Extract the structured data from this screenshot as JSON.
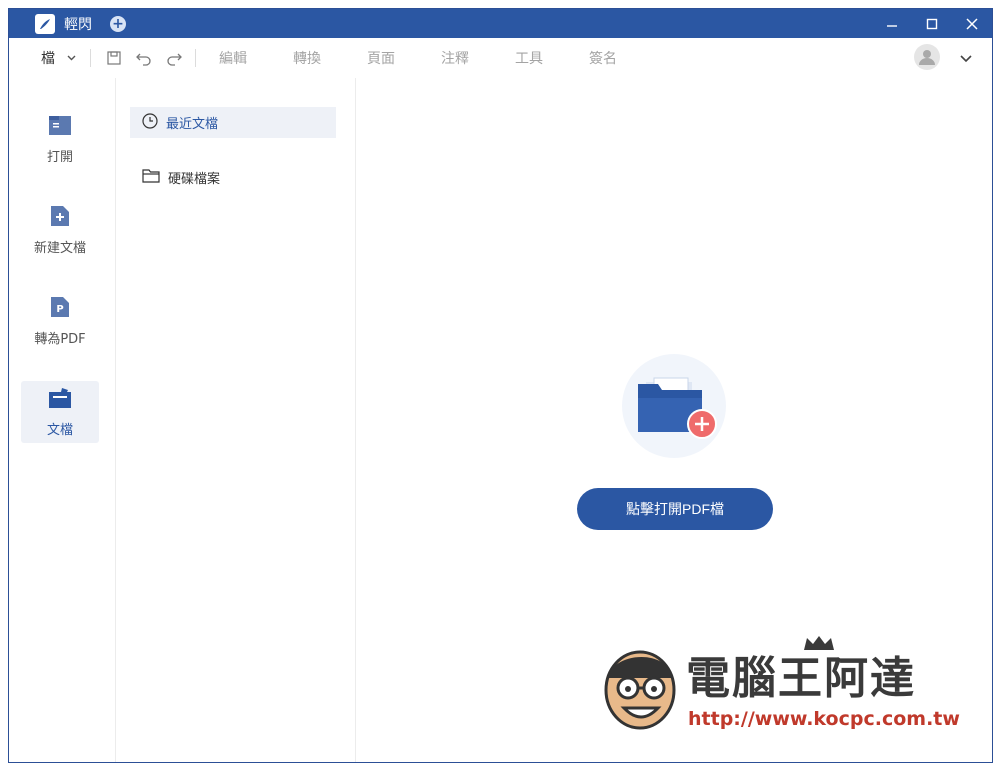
{
  "app": {
    "title": "輕閃"
  },
  "menubar": {
    "file_label": "檔",
    "items": [
      "編輯",
      "轉換",
      "頁面",
      "注釋",
      "工具",
      "簽名"
    ]
  },
  "leftnav": {
    "items": [
      {
        "label": "打開",
        "icon": "open-file-icon"
      },
      {
        "label": "新建文檔",
        "icon": "new-document-icon"
      },
      {
        "label": "轉為PDF",
        "icon": "convert-to-pdf-icon"
      },
      {
        "label": "文檔",
        "icon": "documents-icon",
        "active": true
      }
    ]
  },
  "subpanel": {
    "items": [
      {
        "label": "最近文檔",
        "icon": "clock-icon",
        "active": true
      },
      {
        "label": "硬碟檔案",
        "icon": "folder-icon"
      }
    ]
  },
  "main": {
    "open_button_label": "點擊打開PDF檔"
  },
  "watermark": {
    "title": "電腦王阿達",
    "url": "http://www.kocpc.com.tw"
  },
  "colors": {
    "accent": "#2b57a3",
    "active_bg": "#eef1f7",
    "disabled_text": "#a4a4a4",
    "add_badge": "#ef6b6b"
  }
}
